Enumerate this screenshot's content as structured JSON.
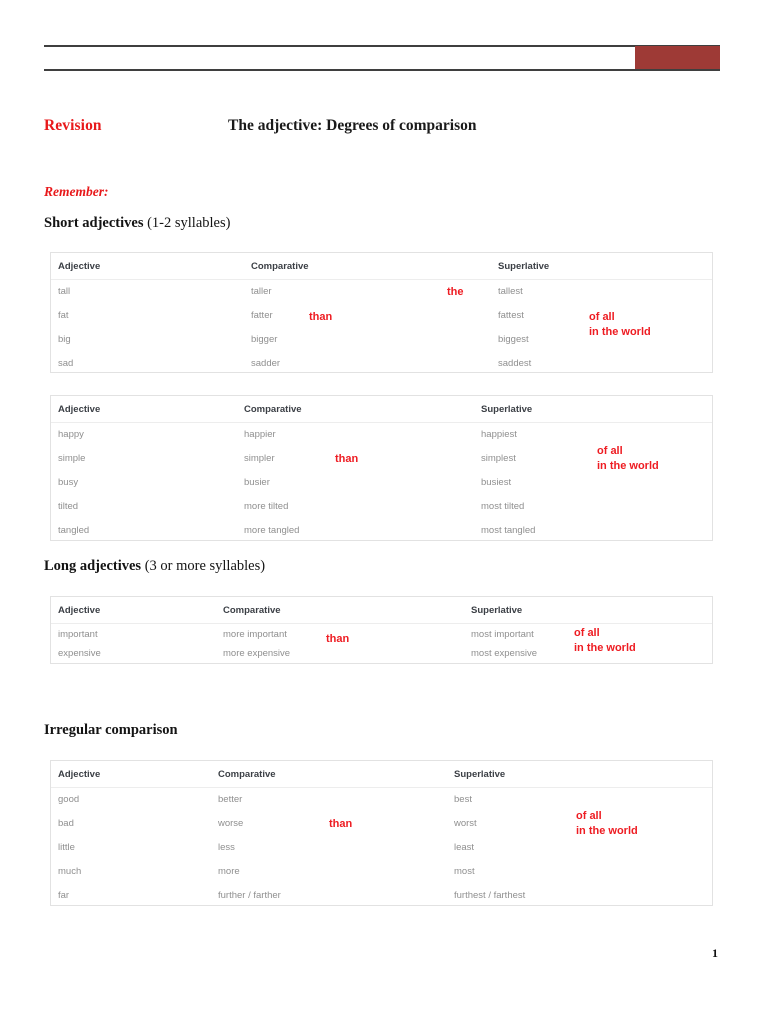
{
  "header": {
    "accent_color": "#9e3a36",
    "rule_color": "#3f3f3f"
  },
  "title_row": {
    "revision_label": "Revision",
    "document_title": "The adjective: Degrees of comparison"
  },
  "remember_label": "Remember:",
  "colors": {
    "red_accent": "#e8191b",
    "annotation_red": "#ee1c22",
    "cell_gray": "#8f8f8f",
    "header_gray": "#3b3f45"
  },
  "sections": {
    "short": {
      "heading_strong": "Short adjectives",
      "heading_light": " (1-2 syllables)"
    },
    "long": {
      "heading_strong": "Long adjectives",
      "heading_light": " (3 or more syllables)"
    },
    "irregular": {
      "heading_strong": "Irregular comparison",
      "heading_light": ""
    }
  },
  "table_headers": {
    "adjective": "Adjective",
    "comparative": "Comparative",
    "superlative": "Superlative"
  },
  "annotations": {
    "the": "the",
    "than": "than",
    "of_all": "of all",
    "in_the_world": "in the world"
  },
  "tables": {
    "short_a": {
      "rows": [
        {
          "adjective": "tall",
          "comparative": "taller",
          "superlative": "tallest"
        },
        {
          "adjective": "fat",
          "comparative": "fatter",
          "superlative": "fattest"
        },
        {
          "adjective": "big",
          "comparative": "bigger",
          "superlative": "biggest"
        },
        {
          "adjective": "sad",
          "comparative": "sadder",
          "superlative": "saddest"
        }
      ]
    },
    "short_b": {
      "rows": [
        {
          "adjective": "happy",
          "comparative": "happier",
          "superlative": "happiest"
        },
        {
          "adjective": "simple",
          "comparative": "simpler",
          "superlative": "simplest"
        },
        {
          "adjective": "busy",
          "comparative": "busier",
          "superlative": "busiest"
        },
        {
          "adjective": "tilted",
          "comparative": "more tilted",
          "superlative": "most tilted"
        },
        {
          "adjective": "tangled",
          "comparative": "more tangled",
          "superlative": "most tangled"
        }
      ]
    },
    "long": {
      "rows": [
        {
          "adjective": "important",
          "comparative": "more important",
          "superlative": "most important"
        },
        {
          "adjective": "expensive",
          "comparative": "more expensive",
          "superlative": "most expensive"
        }
      ]
    },
    "irregular": {
      "rows": [
        {
          "adjective": "good",
          "comparative": "better",
          "superlative": "best"
        },
        {
          "adjective": "bad",
          "comparative": "worse",
          "superlative": "worst"
        },
        {
          "adjective": "little",
          "comparative": "less",
          "superlative": "least"
        },
        {
          "adjective": "much",
          "comparative": "more",
          "superlative": "most"
        },
        {
          "adjective": "far",
          "comparative": "further / farther",
          "superlative": "furthest / farthest"
        }
      ]
    }
  },
  "footer": {
    "page_number": "1"
  }
}
